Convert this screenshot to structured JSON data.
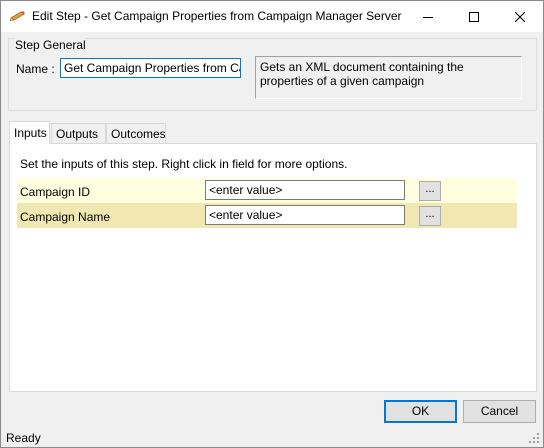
{
  "window": {
    "title": "Edit Step - Get Campaign Properties from Campaign Manager Server",
    "icon": "pencil-icon"
  },
  "step_general": {
    "legend": "Step General",
    "name_label": "Name :",
    "name_value": "Get Campaign Properties from Campa",
    "description": "Gets an XML document containing the properties of a given campaign"
  },
  "tabs": [
    {
      "label": "Inputs",
      "active": true
    },
    {
      "label": "Outputs",
      "active": false
    },
    {
      "label": "Outcomes",
      "active": false
    }
  ],
  "inputs_panel": {
    "hint": "Set the inputs of this step.  Right click in field for more options.",
    "rows": [
      {
        "label": "Campaign ID",
        "value": "<enter value>",
        "button": "..."
      },
      {
        "label": "Campaign Name",
        "value": "<enter value>",
        "button": "..."
      }
    ],
    "row_colors": [
      "#ffffe0",
      "#f0e8b0"
    ]
  },
  "buttons": {
    "ok": "OK",
    "cancel": "Cancel"
  },
  "status": {
    "text": "Ready"
  },
  "colors": {
    "accent": "#0078d7"
  }
}
